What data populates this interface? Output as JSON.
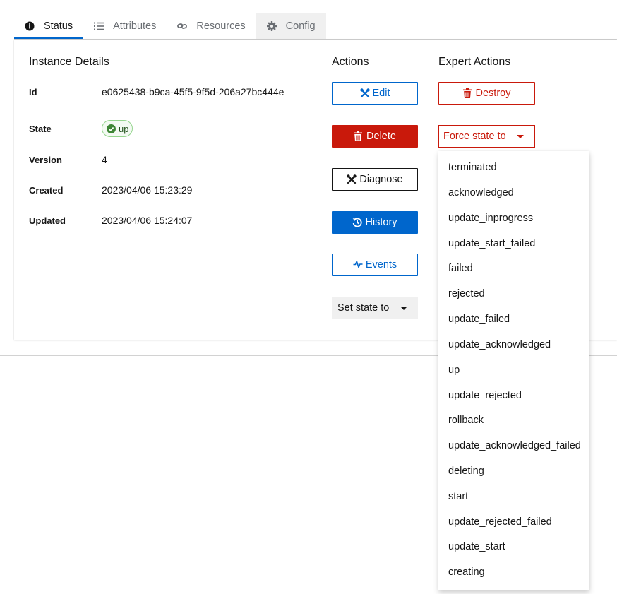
{
  "tabs": [
    {
      "label": "Status",
      "icon": "info-circle-icon",
      "active": true
    },
    {
      "label": "Attributes",
      "icon": "list-icon"
    },
    {
      "label": "Resources",
      "icon": "link-icon"
    },
    {
      "label": "Config",
      "icon": "gear-icon"
    }
  ],
  "details": {
    "title": "Instance Details",
    "id_label": "Id",
    "id_value": "e0625438-b9ca-45f5-9f5d-206a27bc444e",
    "state_label": "State",
    "state_value": "up",
    "version_label": "Version",
    "version_value": "4",
    "created_label": "Created",
    "created_value": "2023/04/06 15:23:29",
    "updated_label": "Updated",
    "updated_value": "2023/04/06 15:24:07"
  },
  "actions": {
    "title": "Actions",
    "edit": "Edit",
    "delete": "Delete",
    "diagnose": "Diagnose",
    "history": "History",
    "events": "Events",
    "set_state": "Set state to"
  },
  "expert": {
    "title": "Expert Actions",
    "destroy": "Destroy",
    "force_state": "Force state to",
    "options": [
      "terminated",
      "acknowledged",
      "update_inprogress",
      "update_start_failed",
      "failed",
      "rejected",
      "update_failed",
      "update_acknowledged",
      "up",
      "update_rejected",
      "rollback",
      "update_acknowledged_failed",
      "deleting",
      "start",
      "update_rejected_failed",
      "update_start",
      "creating"
    ]
  },
  "colors": {
    "primary": "#0066cc",
    "danger": "#c9190b",
    "success": "#3e8635"
  }
}
